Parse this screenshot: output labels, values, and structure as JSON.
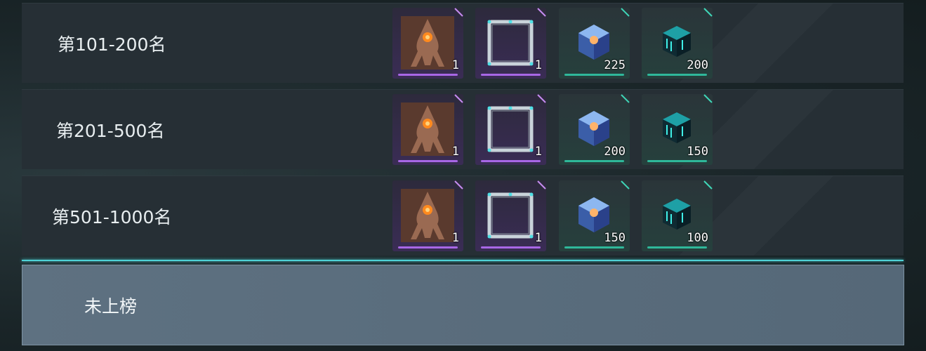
{
  "rows": [
    {
      "rank_label": "第101-200名",
      "rewards": [
        {
          "icon": "creature-portrait-icon",
          "quantity": "1",
          "rarity_color": "#a867e6"
        },
        {
          "icon": "avatar-frame-icon",
          "quantity": "1",
          "rarity_color": "#a867e6"
        },
        {
          "icon": "crystal-cube-icon",
          "quantity": "225",
          "rarity_color": "#2fb89a"
        },
        {
          "icon": "data-cube-icon",
          "quantity": "200",
          "rarity_color": "#2fb89a"
        }
      ]
    },
    {
      "rank_label": "第201-500名",
      "rewards": [
        {
          "icon": "creature-portrait-icon",
          "quantity": "1",
          "rarity_color": "#a867e6"
        },
        {
          "icon": "avatar-frame-icon",
          "quantity": "1",
          "rarity_color": "#a867e6"
        },
        {
          "icon": "crystal-cube-icon",
          "quantity": "200",
          "rarity_color": "#2fb89a"
        },
        {
          "icon": "data-cube-icon",
          "quantity": "150",
          "rarity_color": "#2fb89a"
        }
      ]
    },
    {
      "rank_label": "第501-1000名",
      "rewards": [
        {
          "icon": "creature-portrait-icon",
          "quantity": "1",
          "rarity_color": "#a867e6"
        },
        {
          "icon": "avatar-frame-icon",
          "quantity": "1",
          "rarity_color": "#a867e6"
        },
        {
          "icon": "crystal-cube-icon",
          "quantity": "150",
          "rarity_color": "#2fb89a"
        },
        {
          "icon": "data-cube-icon",
          "quantity": "100",
          "rarity_color": "#2fb89a"
        }
      ]
    }
  ],
  "player_status": {
    "label": "未上榜"
  },
  "colors": {
    "divider_accent": "#4fd2d6",
    "row_background": "#262f35",
    "player_row_background": "#5e7181"
  }
}
